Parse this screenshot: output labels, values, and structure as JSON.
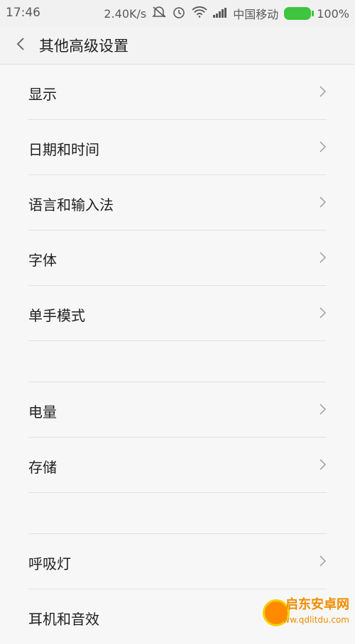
{
  "status": {
    "time": "17:46",
    "speed": "2.40K/s",
    "carrier": "中国移动",
    "battery": "100%"
  },
  "header": {
    "title": "其他高级设置"
  },
  "sections": [
    [
      {
        "label": "显示"
      },
      {
        "label": "日期和时间"
      },
      {
        "label": "语言和输入法"
      },
      {
        "label": "字体"
      },
      {
        "label": "单手模式"
      }
    ],
    [
      {
        "label": "电量"
      },
      {
        "label": "存储"
      }
    ],
    [
      {
        "label": "呼吸灯"
      },
      {
        "label": "耳机和音效"
      }
    ]
  ],
  "watermark": {
    "text_cn": "启东安卓网",
    "url": "www.qdlitdu.com"
  },
  "colors": {
    "accent_battery": "#3ec43e",
    "background": "#f7f7f7"
  }
}
